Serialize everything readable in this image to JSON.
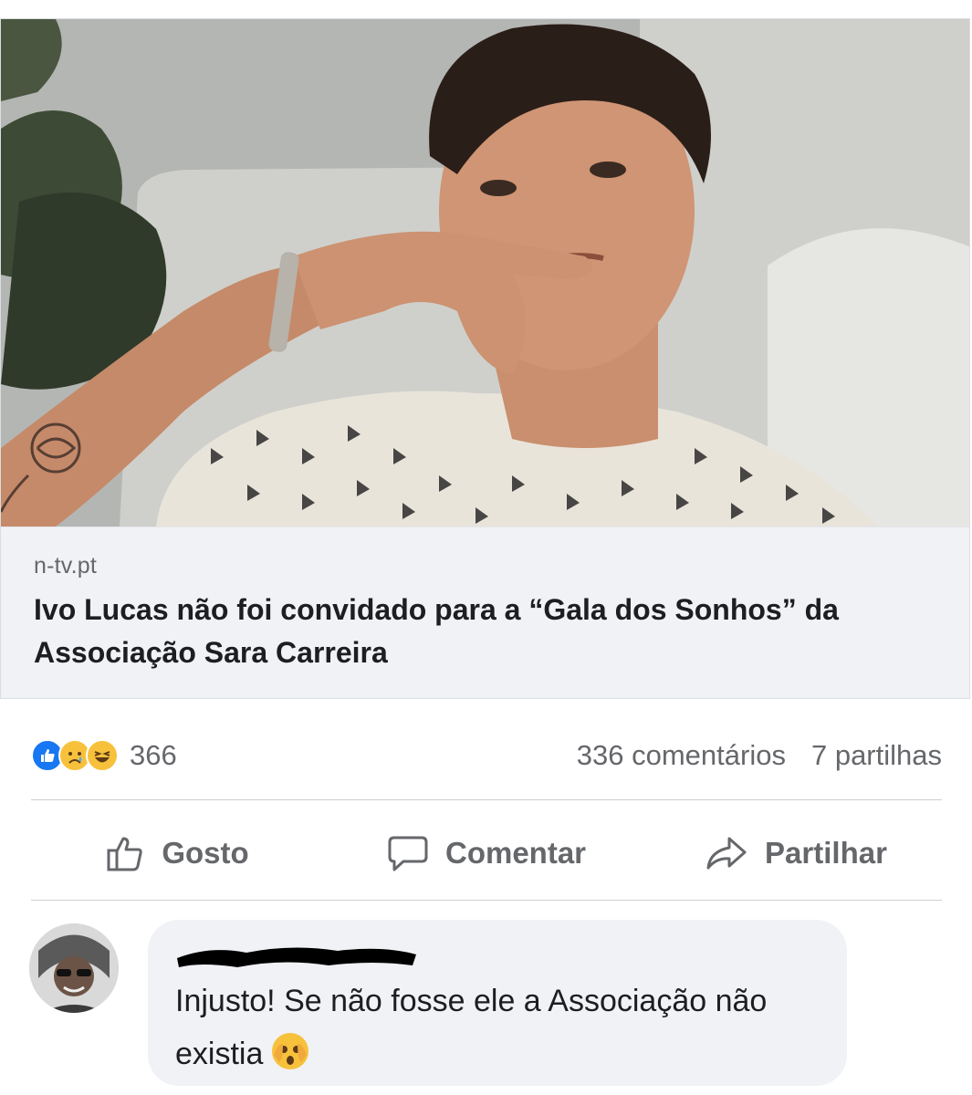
{
  "link_preview": {
    "domain": "n-tv.pt",
    "headline": "Ivo Lucas não foi convidado para a “Gala dos Sonhos” da Associação Sara Carreira",
    "image_description_icon": "photo-icon"
  },
  "reactions": {
    "icons": [
      "like-reaction-icon",
      "sad-reaction-icon",
      "haha-reaction-icon"
    ],
    "count": "366"
  },
  "stats": {
    "comments": "336 comentários",
    "shares": "7 partilhas"
  },
  "actions": {
    "like_label": "Gosto",
    "comment_label": "Comentar",
    "share_label": "Partilhar"
  },
  "comment": {
    "author": "",
    "text": "Injusto! Se não fosse ele a Associação não existia",
    "emoji": "😵"
  },
  "colors": {
    "like_blue": "#1877f2",
    "muted_text": "#65676b",
    "card_meta_bg": "#f0f2f5",
    "comment_bg": "#f0f2f5"
  }
}
